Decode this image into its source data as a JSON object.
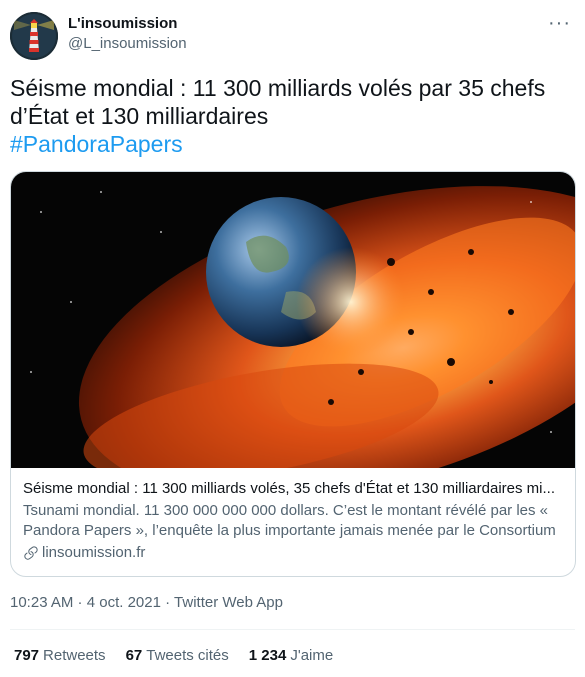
{
  "author": {
    "display_name": "L'insoumission",
    "handle": "@L_insoumission"
  },
  "more_icon": "more-horizontal-icon",
  "tweet": {
    "text": "Séisme mondial : 11 300 milliards volés par 35 chefs d’État et 130 milliardaires",
    "hashtag": "#PandoraPapers"
  },
  "card": {
    "image_alt": "Earth exploding in space",
    "title": "Séisme mondial : 11 300 milliards volés, 35 chefs d'État et 130 milliardaires mi...",
    "description": "Tsunami mondial. 11 300 000 000 000 dollars. C’est le montant révélé par les « Pandora Papers », l’enquête la plus importante jamais menée par le Consortium",
    "domain": "linsoumission.fr",
    "domain_icon": "link-icon"
  },
  "meta": {
    "time": "10:23 AM",
    "separator": " · ",
    "date": "4 oct. 2021",
    "source": "Twitter Web App"
  },
  "stats": {
    "retweets_count": "797",
    "retweets_label": "Retweets",
    "quotes_count": "67",
    "quotes_label": "Tweets cités",
    "likes_count": "1 234",
    "likes_label": "J'aime"
  },
  "colors": {
    "accent": "#1d9bf0",
    "secondary_text": "#536471",
    "border": "#cfd9de"
  }
}
